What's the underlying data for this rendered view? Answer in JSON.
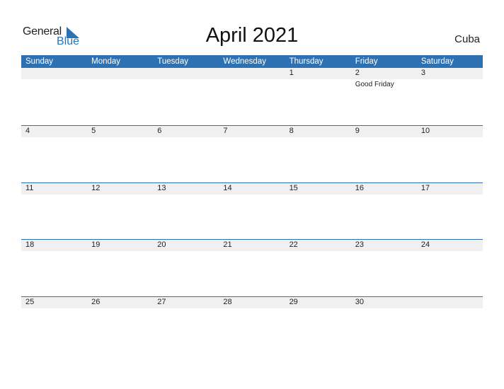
{
  "logo": {
    "general": "General",
    "blue": "Blue"
  },
  "title": "April 2021",
  "country": "Cuba",
  "colors": {
    "accent": "#2e71b3",
    "row_fill": "#f0f0f0"
  },
  "weekdays": [
    "Sunday",
    "Monday",
    "Tuesday",
    "Wednesday",
    "Thursday",
    "Friday",
    "Saturday"
  ],
  "weeks": [
    [
      {
        "day": "",
        "event": ""
      },
      {
        "day": "",
        "event": ""
      },
      {
        "day": "",
        "event": ""
      },
      {
        "day": "",
        "event": ""
      },
      {
        "day": "1",
        "event": ""
      },
      {
        "day": "2",
        "event": "Good Friday"
      },
      {
        "day": "3",
        "event": ""
      }
    ],
    [
      {
        "day": "4",
        "event": ""
      },
      {
        "day": "5",
        "event": ""
      },
      {
        "day": "6",
        "event": ""
      },
      {
        "day": "7",
        "event": ""
      },
      {
        "day": "8",
        "event": ""
      },
      {
        "day": "9",
        "event": ""
      },
      {
        "day": "10",
        "event": ""
      }
    ],
    [
      {
        "day": "11",
        "event": ""
      },
      {
        "day": "12",
        "event": ""
      },
      {
        "day": "13",
        "event": ""
      },
      {
        "day": "14",
        "event": ""
      },
      {
        "day": "15",
        "event": ""
      },
      {
        "day": "16",
        "event": ""
      },
      {
        "day": "17",
        "event": ""
      }
    ],
    [
      {
        "day": "18",
        "event": ""
      },
      {
        "day": "19",
        "event": ""
      },
      {
        "day": "20",
        "event": ""
      },
      {
        "day": "21",
        "event": ""
      },
      {
        "day": "22",
        "event": ""
      },
      {
        "day": "23",
        "event": ""
      },
      {
        "day": "24",
        "event": ""
      }
    ],
    [
      {
        "day": "25",
        "event": ""
      },
      {
        "day": "26",
        "event": ""
      },
      {
        "day": "27",
        "event": ""
      },
      {
        "day": "28",
        "event": ""
      },
      {
        "day": "29",
        "event": ""
      },
      {
        "day": "30",
        "event": ""
      },
      {
        "day": "",
        "event": ""
      }
    ]
  ]
}
